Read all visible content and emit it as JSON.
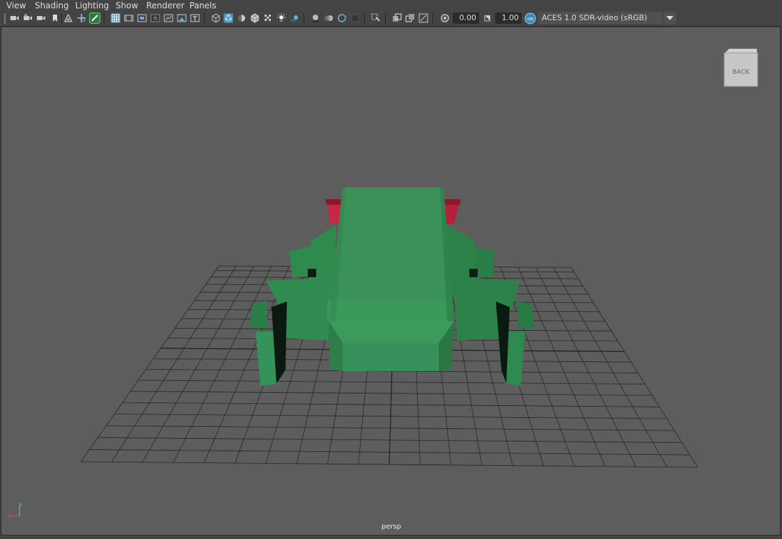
{
  "menu": {
    "view": "View",
    "shading": "Shading",
    "lighting": "Lighting",
    "show": "Show",
    "renderer": "Renderer",
    "panels": "Panels"
  },
  "toolbar": {
    "exposure_value": "0.00",
    "gamma_value": "1.00",
    "color_space": "ACES 1.0 SDR-video (sRGB)",
    "color_management_badge": "ON"
  },
  "viewport": {
    "viewcube_label": "BACK",
    "camera_name": "persp",
    "axis_y_label": "y",
    "axis_x_label": "x"
  },
  "colors": {
    "model_green": "#3a9258",
    "model_red": "#b42038",
    "active_button": "#5285a6",
    "viewport_bg": "#5d5d5d"
  }
}
